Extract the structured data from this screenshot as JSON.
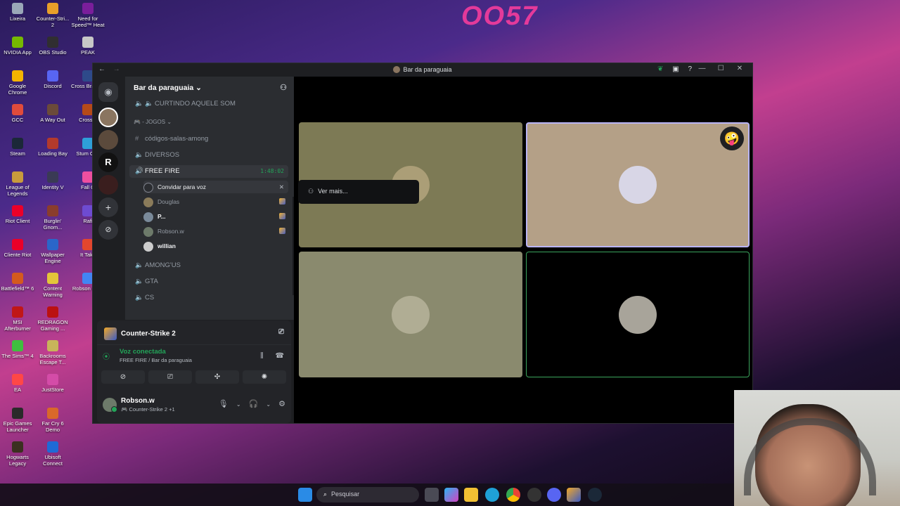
{
  "wallpaper": {
    "title": "OO57"
  },
  "desktop_icons": [
    {
      "label": "Lixeira",
      "color": "#9aa7b8"
    },
    {
      "label": "NVIDIA App",
      "color": "#76b900"
    },
    {
      "label": "Google Chrome",
      "color": "#f4b400"
    },
    {
      "label": "GCC",
      "color": "#e04b3b"
    },
    {
      "label": "Steam",
      "color": "#1b2838"
    },
    {
      "label": "League of Legends",
      "color": "#c89b3c"
    },
    {
      "label": "Riot Client",
      "color": "#eb0029"
    },
    {
      "label": "Cliente Riot",
      "color": "#eb0029"
    },
    {
      "label": "Battlefield™ 6",
      "color": "#d45a1e"
    },
    {
      "label": "MSI Afterburner",
      "color": "#c01717"
    },
    {
      "label": "The Sims™ 4",
      "color": "#3fbf3f"
    },
    {
      "label": "EA",
      "color": "#ff4747"
    },
    {
      "label": "Epic Games Launcher",
      "color": "#2a2a2a"
    },
    {
      "label": "Hogwarts Legacy",
      "color": "#3b3020"
    },
    {
      "label": "Counter-Stri... 2",
      "color": "#e89f29"
    },
    {
      "label": "OBS Studio",
      "color": "#302e31"
    },
    {
      "label": "Discord",
      "color": "#5865f2"
    },
    {
      "label": "A Way Out",
      "color": "#6b4a3a"
    },
    {
      "label": "Loading Bay",
      "color": "#b33a2c"
    },
    {
      "label": "Identity V",
      "color": "#3a3a55"
    },
    {
      "label": "Burglin' Gnom...",
      "color": "#8a3d2d"
    },
    {
      "label": "Wallpaper Engine",
      "color": "#2a66c9"
    },
    {
      "label": "Content Warning",
      "color": "#e3c53a"
    },
    {
      "label": "REDRAGON Gaming ...",
      "color": "#b11"
    },
    {
      "label": "Backrooms Escape T...",
      "color": "#c8b45a"
    },
    {
      "label": "JustStore",
      "color": "#d44ca8"
    },
    {
      "label": "Far Cry 6 Demo",
      "color": "#d9682a"
    },
    {
      "label": "Ubisoft Connect",
      "color": "#1f6ad6"
    },
    {
      "label": "Need for Speed™ Heat",
      "color": "#7a1e9b"
    },
    {
      "label": "PEAK",
      "color": "#c7c7c7"
    },
    {
      "label": "Cross Brasil D",
      "color": "#2e4a8a"
    },
    {
      "label": "CrossFi",
      "color": "#b64a19"
    },
    {
      "label": "Stum Guy",
      "color": "#2e9fd9"
    },
    {
      "label": "Fall G",
      "color": "#ee4fa0"
    },
    {
      "label": "Rafi",
      "color": "#6e4bd1"
    },
    {
      "label": "It Take",
      "color": "#e3462e"
    },
    {
      "label": "Robson Chro",
      "color": "#4285f4"
    }
  ],
  "window": {
    "title": "Bar da paraguaia",
    "nav_back": "←",
    "nav_forward": "→"
  },
  "server": {
    "name": "Bar da paraguaia",
    "chevron": "⌄",
    "add_member_icon": "person-add-icon"
  },
  "channels": {
    "top_channel": "CURTINDO AQUELE SOM",
    "category": "- JOGOS",
    "items": [
      {
        "name": "códigos-salas-among",
        "type": "text"
      },
      {
        "name": "DIVERSOS",
        "type": "voice"
      },
      {
        "name": "FREE FIRE",
        "type": "voice",
        "timer": "1:48:02"
      },
      {
        "name": "AMONG'US",
        "type": "voice"
      },
      {
        "name": "GTA",
        "type": "voice"
      },
      {
        "name": "CS",
        "type": "voice"
      }
    ],
    "voice_users": [
      {
        "name": "Convidar para voz",
        "kind": "invite"
      },
      {
        "name": "Douglas",
        "kind": "user",
        "game": true
      },
      {
        "name": "P...",
        "kind": "user",
        "game": true
      },
      {
        "name": "Robson.w",
        "kind": "user",
        "game": true
      },
      {
        "name": "willian",
        "kind": "user",
        "game": false
      }
    ]
  },
  "activity": {
    "game": "Counter-Strike 2"
  },
  "voice_status": {
    "title": "Voz conectada",
    "subtitle": "FREE FIRE / Bar da paraguaia"
  },
  "user": {
    "name": "Robson.w",
    "status": "Counter-Strike 2 +1"
  },
  "stage": {
    "menu_label": "Ver mais...",
    "tiles": [
      {
        "bg": "#7d7a55",
        "speaking": false,
        "avatar": "#c9b58e"
      },
      {
        "bg": "#b4a087",
        "speaking": true,
        "avatar": "#d8d6e6",
        "emoji": "🤪"
      },
      {
        "bg": "#8a8a6e",
        "speaking": false,
        "avatar": "#cfcab5"
      },
      {
        "bg": "#000000",
        "speaking": false,
        "green": true,
        "avatar": "#a8a49a"
      }
    ]
  },
  "taskbar": {
    "search_placeholder": "Pesquisar",
    "apps": [
      "windows-start-icon",
      "task-view-icon",
      "copilot-icon",
      "file-explorer-icon",
      "edge-icon",
      "chrome-icon",
      "gcc-icon",
      "discord-icon",
      "counter-strike-icon",
      "steam-icon"
    ]
  }
}
